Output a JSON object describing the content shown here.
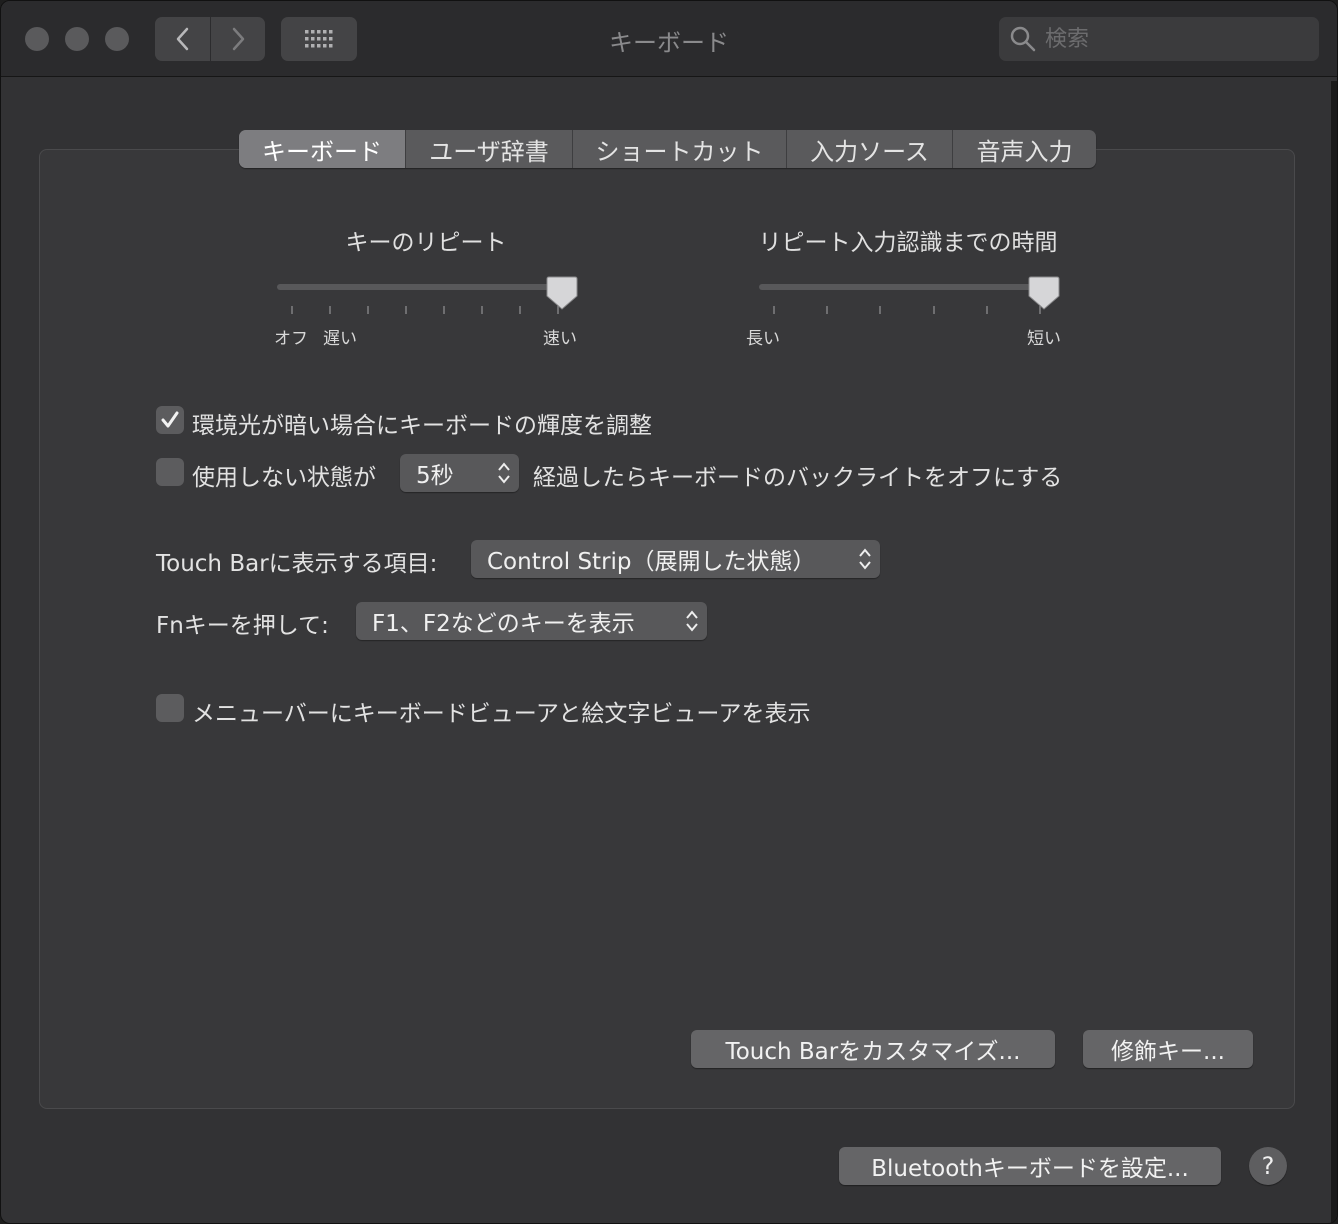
{
  "window": {
    "title": "キーボード"
  },
  "toolbar": {
    "back_icon": "chevron-left-icon",
    "forward_icon": "chevron-right-icon",
    "show_all_icon": "grid-icon",
    "search_placeholder": "検索"
  },
  "tabs": [
    {
      "label": "キーボード",
      "active": true
    },
    {
      "label": "ユーザ辞書",
      "active": false
    },
    {
      "label": "ショートカット",
      "active": false
    },
    {
      "label": "入力ソース",
      "active": false
    },
    {
      "label": "音声入力",
      "active": false
    }
  ],
  "key_repeat": {
    "title": "キーのリピート",
    "label_off": "オフ",
    "label_slow": "遅い",
    "label_fast": "速い",
    "value_fraction": 1.0
  },
  "repeat_delay": {
    "title": "リピート入力認識までの時間",
    "label_long": "長い",
    "label_short": "短い",
    "value_fraction": 1.0
  },
  "options": {
    "adjust_brightness": {
      "label": "環境光が暗い場合にキーボードの輝度を調整",
      "checked": true
    },
    "backlight_off": {
      "label_before": "使用しない状態が",
      "popup_value": "5秒",
      "label_after": "経過したらキーボードのバックライトをオフにする",
      "checked": false
    },
    "touchbar_shows": {
      "label": "Touch Barに表示する項目:",
      "popup_value": "Control Strip（展開した状態）"
    },
    "fn_key": {
      "label": "Fnキーを押して:",
      "popup_value": "F1、F2などのキーを表示"
    },
    "show_viewers": {
      "label": "メニューバーにキーボードビューアと絵文字ビューアを表示",
      "checked": false
    }
  },
  "buttons": {
    "customize_touchbar": "Touch Barをカスタマイズ...",
    "modifier_keys": "修飾キー...",
    "bluetooth_keyboard": "Bluetoothキーボードを設定...",
    "help": "?"
  },
  "colors": {
    "window_bg": "#323234",
    "panel_bg": "#38383a",
    "control": "#58585a",
    "active_tab": "#7d7d80"
  }
}
